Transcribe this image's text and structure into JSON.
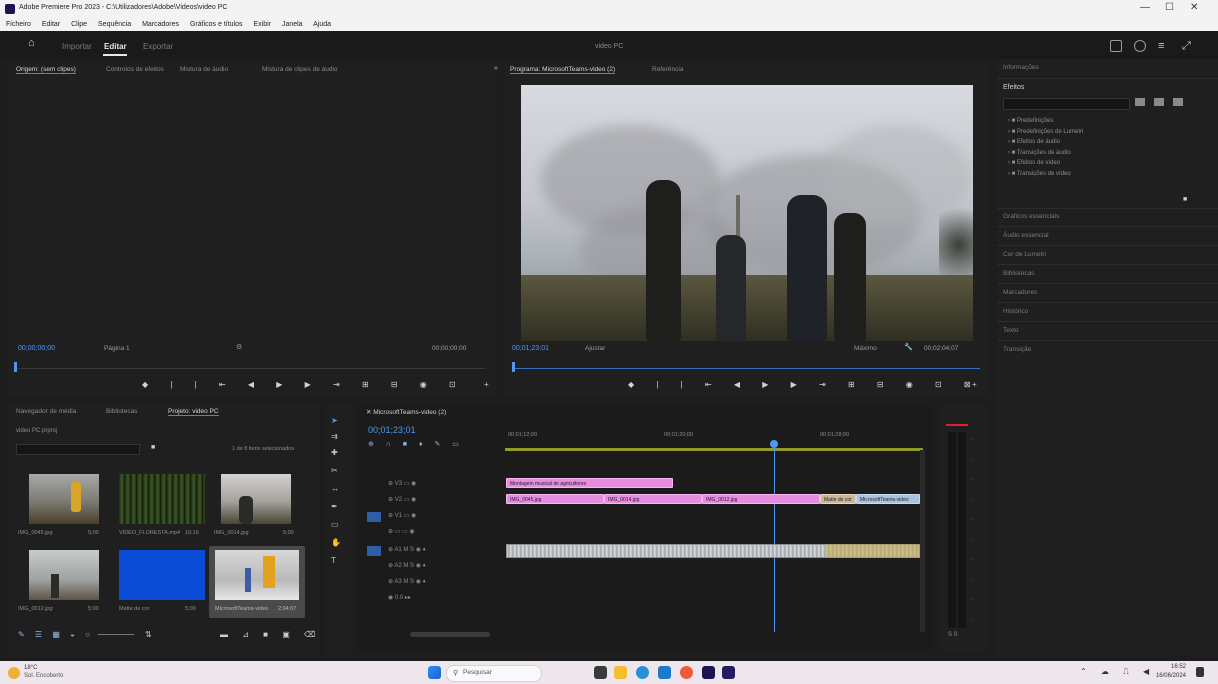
{
  "titlebar": {
    "title": "Adobe Premiere Pro 2023 - C:\\Utilizadores\\Adobe\\Videos\\video PC",
    "minimize": "—",
    "maximize": "☐",
    "close": "✕"
  },
  "menu": [
    "Ficheiro",
    "Editar",
    "Clipe",
    "Sequência",
    "Marcadores",
    "Gráficos e títulos",
    "Exibir",
    "Janela",
    "Ajuda"
  ],
  "workspace": {
    "modes": [
      "Importar",
      "Editar",
      "Exportar"
    ],
    "project_title": "video PC"
  },
  "source_monitor": {
    "tabs": [
      "Origem: (sem clipes)",
      "Controlos de efeitos",
      "Mistura de áudio",
      "Mistura de clipes de áudio"
    ],
    "timecode_in": "00;00;00;00",
    "fit": "Página 1",
    "timecode_out": "00;00;00;00"
  },
  "program_monitor": {
    "tabs": [
      "Programa: MicrosoftTeams-video (2)",
      "Referência"
    ],
    "timecode": "00;01;23;01",
    "fit": "Ajustar",
    "quality": "Máximo",
    "duration": "00;02;04;07"
  },
  "project_panel": {
    "tabs": [
      "Navegador de média",
      "Bibliotecas",
      "Projeto: video PC"
    ],
    "name": "video PC.prproj",
    "items_label": "1 de 8 itens selecionados",
    "clips": [
      {
        "name": "IMG_0045.jpg",
        "dur": "5;00"
      },
      {
        "name": "VIDEO_FLORESTA.mp4",
        "dur": "10;16"
      },
      {
        "name": "IMG_0014.jpg",
        "dur": "5;00"
      },
      {
        "name": "IMG_0012.jpg",
        "dur": "5;00"
      },
      {
        "name": "Matte de cor",
        "dur": "5;00"
      },
      {
        "name": "MicrosoftTeams-video",
        "dur": "2;04;07"
      }
    ]
  },
  "timeline": {
    "tab": "MicrosoftTeams-video (2)",
    "timecode": "00;01;23;01",
    "ruler": [
      "00;01;12;00",
      "00;01;20;00",
      "00;01;28;00"
    ],
    "tracks_video": [
      "V3",
      "V2",
      "V1"
    ],
    "tracks_audio": [
      "A1",
      "A2",
      "A3"
    ],
    "clips": {
      "v3": "Montagem musical de agricultores",
      "v2a": "IMG_0045.jpg",
      "v2b": "IMG_0014.jpg",
      "v2c": "IMG_0012.jpg",
      "v2d": "Matte de cor",
      "v2e": "MicrosoftTeams-video"
    }
  },
  "right_panel": {
    "title": "Informações",
    "effects_tab": "Efeitos",
    "folders": [
      "Predefinições",
      "Predefinições de Lumetri",
      "Efeitos de áudio",
      "Transições de áudio",
      "Efeitos de vídeo",
      "Transições de vídeo"
    ],
    "sections": [
      "Gráficos essenciais",
      "Áudio essencial",
      "Cor de Lumetri",
      "Bibliotecas",
      "Marcadores",
      "Histórico",
      "Texto",
      "Transição"
    ]
  },
  "taskbar": {
    "weather_temp": "18°C",
    "weather_desc": "Sol. Encoberto",
    "search": "Pesquisar",
    "time": "16:52",
    "date": "16/06/2024"
  }
}
